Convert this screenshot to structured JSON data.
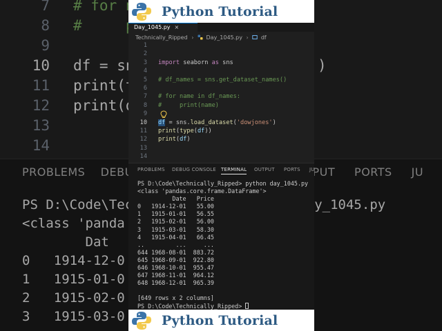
{
  "banner": {
    "title": "Python Tutorial"
  },
  "editor": {
    "tab_label": "Day_1045.py",
    "tab_close": "×",
    "breadcrumb": {
      "folder": "Technically_Ripped",
      "file": "Day_1045.py",
      "symbol": "df"
    },
    "lines": [
      {
        "n": "1",
        "segments": []
      },
      {
        "n": "2",
        "segments": []
      },
      {
        "n": "3",
        "segments": [
          {
            "c": "kw",
            "t": "import "
          },
          {
            "c": "",
            "t": "seaborn "
          },
          {
            "c": "kw",
            "t": "as "
          },
          {
            "c": "",
            "t": "sns"
          }
        ]
      },
      {
        "n": "4",
        "segments": []
      },
      {
        "n": "5",
        "segments": [
          {
            "c": "cm",
            "t": "# df_names = sns.get_dataset_names()"
          }
        ]
      },
      {
        "n": "6",
        "segments": []
      },
      {
        "n": "7",
        "segments": [
          {
            "c": "cm",
            "t": "# for name in df_names:"
          }
        ]
      },
      {
        "n": "8",
        "segments": [
          {
            "c": "cm",
            "t": "#     print(name)"
          }
        ]
      },
      {
        "n": "9",
        "segments": []
      },
      {
        "n": "10",
        "segments": [
          {
            "c": "hl",
            "t": "df"
          },
          {
            "c": "",
            "t": " = sns."
          },
          {
            "c": "fn",
            "t": "load_dataset"
          },
          {
            "c": "",
            "t": "("
          },
          {
            "c": "st",
            "t": "'dowjones'"
          },
          {
            "c": "",
            "t": ")"
          }
        ]
      },
      {
        "n": "11",
        "segments": [
          {
            "c": "fn",
            "t": "print"
          },
          {
            "c": "",
            "t": "("
          },
          {
            "c": "fn",
            "t": "type"
          },
          {
            "c": "",
            "t": "("
          },
          {
            "c": "vr",
            "t": "df"
          },
          {
            "c": "",
            "t": "))"
          }
        ]
      },
      {
        "n": "12",
        "segments": [
          {
            "c": "fn",
            "t": "print"
          },
          {
            "c": "",
            "t": "("
          },
          {
            "c": "vr",
            "t": "df"
          },
          {
            "c": "",
            "t": ")"
          }
        ]
      },
      {
        "n": "13",
        "segments": []
      },
      {
        "n": "14",
        "segments": []
      }
    ],
    "current_line": "10"
  },
  "panel": {
    "tabs": [
      "PROBLEMS",
      "DEBUG CONSOLE",
      "TERMINAL",
      "OUTPUT",
      "PORTS",
      "JU"
    ],
    "active_tab": "TERMINAL"
  },
  "terminal": {
    "lines": [
      "PS D:\\Code\\Technically_Ripped> python day_1045.py",
      "<class 'pandas.core.frame.DataFrame'>",
      "          Date   Price",
      "0   1914-12-01   55.00",
      "1   1915-01-01   56.55",
      "2   1915-02-01   56.00",
      "3   1915-03-01   58.30",
      "4   1915-04-01   66.45",
      "..         ...     ...",
      "644 1968-08-01  883.72",
      "645 1968-09-01  922.80",
      "646 1968-10-01  955.47",
      "647 1968-11-01  964.12",
      "648 1968-12-01  965.39",
      "",
      "[649 rows x 2 columns]",
      "PS D:\\Code\\Technically_Ripped> "
    ]
  },
  "background": {
    "editor_lines": [
      {
        "n": "7",
        "t": "# for n"
      },
      {
        "n": "8",
        "t": "#     p"
      },
      {
        "n": "9",
        "t": ""
      },
      {
        "n": "10",
        "t": "df = sns                 es')"
      },
      {
        "n": "11",
        "t": "print(t"
      },
      {
        "n": "12",
        "t": "print(d"
      },
      {
        "n": "13",
        "t": ""
      },
      {
        "n": "14",
        "t": ""
      }
    ],
    "tabs_left": "PROBLEMS    DEBU",
    "tabs_right": "UTPUT     PORTS     JU",
    "term_lines": [
      "PS D:\\Code\\Tec                   n day_1045.py",
      "<class 'panda                   >",
      "        Dat",
      "0   1914-12-0",
      "1   1915-01-0",
      "2   1915-02-0",
      "3   1915-03-0"
    ]
  },
  "colors": {
    "accent": "#0078d4",
    "banner_text": "#2d5a83",
    "editor_bg": "#1f1f1f"
  }
}
